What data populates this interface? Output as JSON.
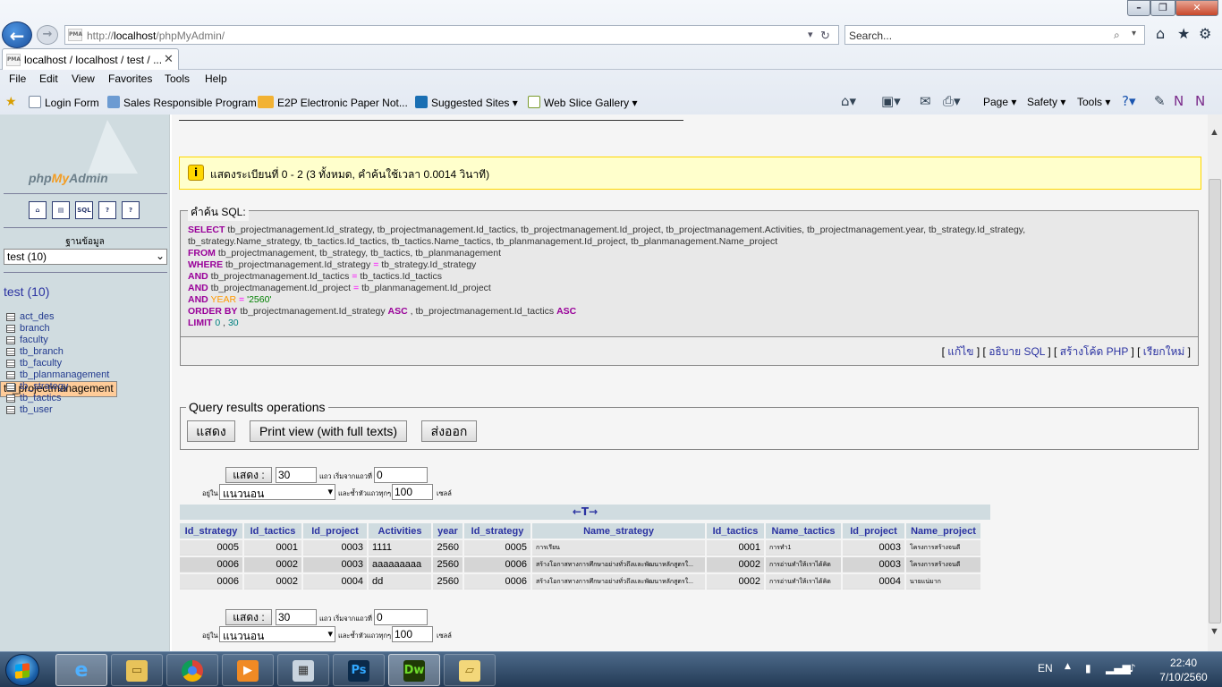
{
  "browser": {
    "url_prefix": "http://",
    "url_host": "localhost",
    "url_path": "/phpMyAdmin/",
    "search_placeholder": "Search...",
    "tab_title": "localhost / localhost / test / ...",
    "menu": [
      "File",
      "Edit",
      "View",
      "Favorites",
      "Tools",
      "Help"
    ],
    "favorites": [
      "Login Form",
      "Sales Responsible Program",
      "E2P  Electronic Paper Not...",
      "Suggested Sites ▾",
      "Web Slice Gallery ▾"
    ],
    "commands": [
      "Page ▾",
      "Safety ▾",
      "Tools ▾"
    ]
  },
  "sidebar": {
    "logo_php": "php",
    "logo_my": "My",
    "logo_admin": "Admin",
    "icons": [
      "home-icon",
      "query-window-icon",
      "sql-icon",
      "docs-icon",
      "help-icon"
    ],
    "icon_text": [
      "⌂",
      "▤",
      "SQL",
      "?",
      "?"
    ],
    "db_label": "ฐานข้อมูล",
    "db_selected": "test (10)",
    "db_title": "test (10)",
    "tables": [
      "act_des",
      "branch",
      "faculty",
      "tb_branch",
      "tb_faculty",
      "tb_planmanagement",
      "tb_projectmanagement",
      "tb_strategy",
      "tb_tactics",
      "tb_user"
    ],
    "selected_table": "tb_projectmanagement"
  },
  "notice": {
    "text": "แสดงระเบียนที่ 0 - 2 (3 ทั้งหมด, คำค้นใช้เวลา 0.0014 วินาที)"
  },
  "sql": {
    "legend": "คำค้น SQL:",
    "select_cols": " tb_projectmanagement.Id_strategy, tb_projectmanagement.Id_tactics, tb_projectmanagement.Id_project, tb_projectmanagement.Activities, tb_projectmanagement.year, tb_strategy.Id_strategy,",
    "select_cols2": "tb_strategy.Name_strategy, tb_tactics.Id_tactics, tb_tactics.Name_tactics, tb_planmanagement.Id_project, tb_planmanagement.Name_project",
    "from_tables": " tb_projectmanagement, tb_strategy, tb_tactics, tb_planmanagement",
    "where_lhs": " tb_projectmanagement.Id_strategy ",
    "where_rhs": " tb_strategy.Id_strategy",
    "and1_lhs": " tb_projectmanagement.Id_tactics ",
    "and1_rhs": " tb_tactics.Id_tactics",
    "and2_lhs": " tb_projectmanagement.Id_project ",
    "and2_rhs": " tb_planmanagement.Id_project",
    "year_kw": "YEAR",
    "year_val": "'2560'",
    "order_cols1": " tb_projectmanagement.Id_strategy ",
    "order_cols2": " , tb_projectmanagement.Id_tactics ",
    "asc": "ASC",
    "limit_a": "0",
    "limit_b": "30",
    "links": [
      "แก้ไข",
      "อธิบาย SQL",
      "สร้างโค้ด PHP",
      "เรียกใหม่"
    ]
  },
  "qro": {
    "legend": "Query results operations",
    "btn_show": "แสดง",
    "btn_print": "Print view (with full texts)",
    "btn_export": "ส่งออก"
  },
  "nav": {
    "show_label": "แสดง :",
    "rows": "30",
    "start_label": "แถว เริ่มจากแถวที่",
    "start": "0",
    "in_label": "อยู่ใน",
    "mode": "แนวนอน",
    "repeat_label": "และซ้ำหัวแถวทุกๆ",
    "repeat": "100",
    "cells_label": "เซลล์"
  },
  "results": {
    "arrows": "←T→",
    "columns": [
      "Id_strategy",
      "Id_tactics",
      "Id_project",
      "Activities",
      "year",
      "Id_strategy",
      "Name_strategy",
      "Id_tactics",
      "Name_tactics",
      "Id_project",
      "Name_project"
    ],
    "rows": [
      [
        "0005",
        "0001",
        "0003",
        "1111",
        "2560",
        "0005",
        "การเรียน",
        "0001",
        "การทำ1",
        "0003",
        "โครงการสร้างจนดี"
      ],
      [
        "0006",
        "0002",
        "0003",
        "aaaaaaaaa",
        "2560",
        "0006",
        "สร้างโอกาสทางการศึกษาอย่างทั่วถึงและพัฒนาหลักสูตรใ...",
        "0002",
        "การอ่านทำให้เราได้คิด",
        "0003",
        "โครงการสร้างจนดี"
      ],
      [
        "0006",
        "0002",
        "0004",
        "dd",
        "2560",
        "0006",
        "สร้างโอกาสทางการศึกษาอย่างทั่วถึงและพัฒนาหลักสูตรใ...",
        "0002",
        "การอ่านทำให้เราได้คิด",
        "0004",
        "นายแน่มาก"
      ]
    ]
  },
  "taskbar": {
    "apps": [
      "Internet Explorer",
      "Windows Explorer",
      "Chrome",
      "Media Player",
      "Calculator",
      "Photoshop",
      "Dreamweaver",
      "Folder"
    ],
    "app_glyphs": [
      "e",
      "▭",
      "●",
      "▶",
      "▦",
      "Ps",
      "Dw",
      "▱"
    ],
    "lang": "EN",
    "time": "22:40",
    "date": "7/10/2560"
  }
}
